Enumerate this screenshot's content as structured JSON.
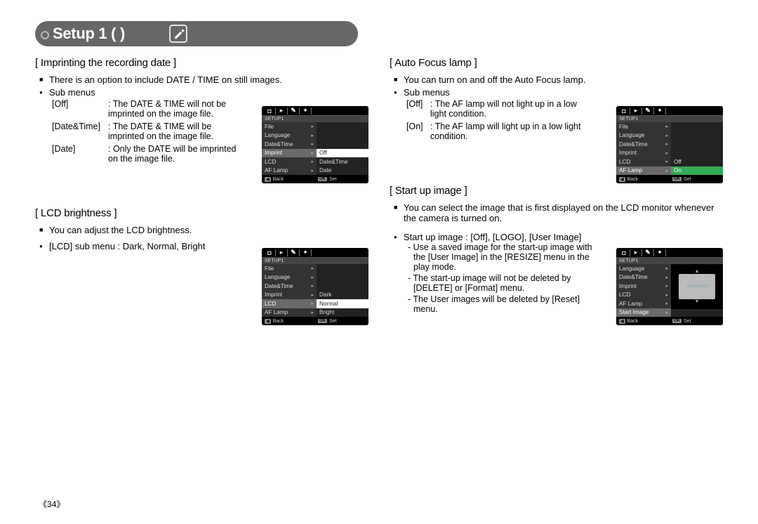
{
  "page_title": "Setup 1 (       )",
  "page_number": "34",
  "sections": {
    "imprint": {
      "title": "[ Imprinting the recording date ]",
      "intro": "There is an option to include DATE / TIME on still images.",
      "sub_label": "Sub menus",
      "rows": [
        {
          "key": "[Off]",
          "val": ": The DATE & TIME will not be imprinted on the image file."
        },
        {
          "key": "[Date&Time]",
          "val": ": The DATE & TIME will be imprinted on the image file."
        },
        {
          "key": "[Date]",
          "val": ": Only the DATE will be imprinted on the image file."
        }
      ],
      "menu": {
        "setup_label": "SETUP1",
        "left": [
          "File",
          "Language",
          "Date&Time",
          "Imprint",
          "LCD",
          "AF Lamp"
        ],
        "left_selected": 3,
        "right": [
          "Off",
          "Date&Time",
          "Date"
        ],
        "right_selected": 0,
        "foot_back": "Back",
        "foot_ok": "OK",
        "foot_set": "Set"
      }
    },
    "lcd": {
      "title": "[ LCD brightness ]",
      "intro": "You can adjust the LCD brightness.",
      "sub_label": "[LCD] sub menu : Dark, Normal, Bright",
      "menu": {
        "setup_label": "SETUP1",
        "left": [
          "File",
          "Language",
          "Date&Time",
          "Imprint",
          "LCD",
          "AF Lamp"
        ],
        "left_selected": 4,
        "right": [
          "Dark",
          "Normal",
          "Bright"
        ],
        "right_selected": 1,
        "foot_back": "Back",
        "foot_ok": "OK",
        "foot_set": "Set"
      }
    },
    "af": {
      "title": "[ Auto Focus lamp ]",
      "intro": "You can turn on and off the Auto Focus lamp.",
      "sub_label": "Sub menus",
      "rows": [
        {
          "key": "[Off]",
          "val": ": The AF lamp will not light up in a low light condition."
        },
        {
          "key": "[On]",
          "val": ": The AF lamp will light up in a low light condition."
        }
      ],
      "menu": {
        "setup_label": "SETUP1",
        "left": [
          "File",
          "Language",
          "Date&Time",
          "Imprint",
          "LCD",
          "AF Lamp"
        ],
        "left_selected": 5,
        "right": [
          "Off",
          "On"
        ],
        "right_selected": 1,
        "right_selected_color": "green",
        "foot_back": "Back",
        "foot_ok": "OK",
        "foot_set": "Set"
      }
    },
    "start": {
      "title": "[ Start up image ]",
      "intro": "You can select the image that is first displayed on the LCD monitor whenever the camera is turned on.",
      "sub_label": "Start up image : [Off], [LOGO], [User Image]",
      "dashes": [
        "- Use a saved image for the start-up image with the [User Image] in the [RESIZE] menu in the play mode.",
        "- The start-up image will not be deleted by [DELETE] or [Format] menu.",
        "- The User images will be deleted by [Reset] menu."
      ],
      "menu": {
        "setup_label": "SETUP1",
        "left": [
          "Language",
          "Date&Time",
          "Imprint",
          "LCD",
          "AF Lamp",
          "Start Image"
        ],
        "left_selected": 5,
        "preview_brand": "SAMSUNG",
        "foot_back": "Back",
        "foot_ok": "OK",
        "foot_set": "Set"
      }
    }
  }
}
